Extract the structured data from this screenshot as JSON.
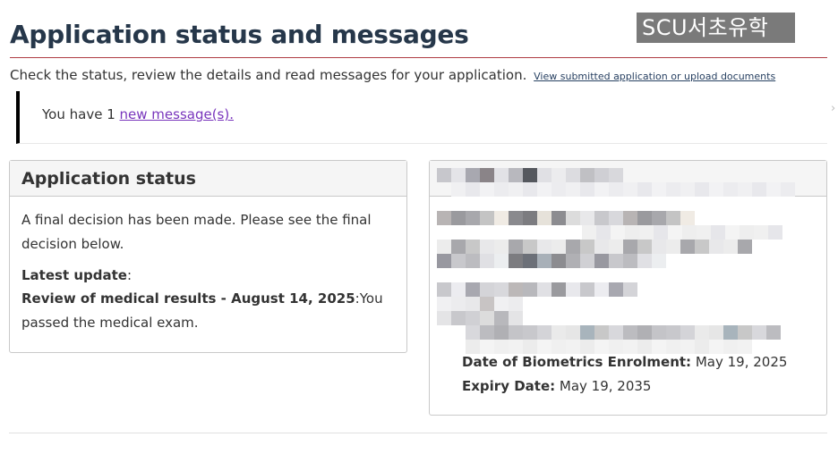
{
  "page": {
    "title": "Application status and messages",
    "watermark": "SCU서초유학",
    "intro": "Check the status, review the details and read messages for your application.",
    "view_link": "View submitted application or upload documents"
  },
  "notice": {
    "prefix": "You have 1 ",
    "link": "new message(s)."
  },
  "status_panel": {
    "heading": "Application status",
    "decision": "A final decision has been made. Please see the final decision below.",
    "latest_label": "Latest update",
    "latest_colon": ":",
    "update_title": "Review of medical results - August 14, 2025",
    "update_text": ":You passed the medical exam."
  },
  "biometrics_panel": {
    "enrolment_label": "Date of Biometrics Enrolment:",
    "enrolment_value": " May 19, 2025",
    "expiry_label": "Expiry Date:",
    "expiry_value": " May 19, 2035"
  },
  "icons": {
    "chevron": "chevron-right-icon"
  }
}
